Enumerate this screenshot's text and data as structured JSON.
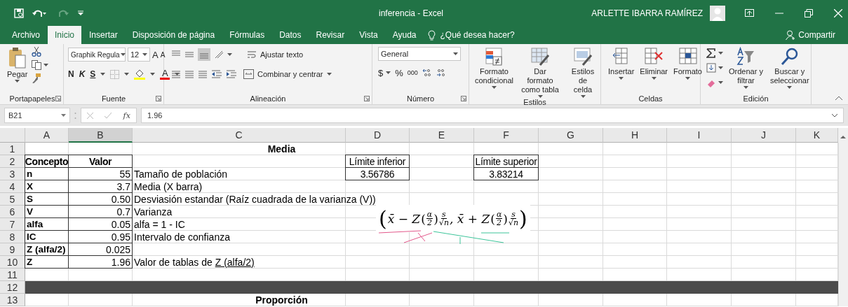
{
  "window": {
    "title": "inferencia - Excel",
    "user": "ARLETTE IBARRA RAMÍREZ"
  },
  "tabs": {
    "items": [
      {
        "label": "Archivo",
        "selected": false
      },
      {
        "label": "Inicio",
        "selected": true
      },
      {
        "label": "Insertar",
        "selected": false
      },
      {
        "label": "Disposición de página",
        "selected": false
      },
      {
        "label": "Fórmulas",
        "selected": false
      },
      {
        "label": "Datos",
        "selected": false
      },
      {
        "label": "Revisar",
        "selected": false
      },
      {
        "label": "Vista",
        "selected": false
      },
      {
        "label": "Ayuda",
        "selected": false
      }
    ],
    "tell_me": {
      "placeholder": "¿Qué desea hacer?"
    },
    "share": "Compartir"
  },
  "ribbon": {
    "clipboard": {
      "label": "Portapapeles",
      "paste": "Pegar"
    },
    "font": {
      "label": "Fuente",
      "font_name": "Graphik Regula",
      "font_size": "12",
      "grow": "A",
      "shrink": "A",
      "bold": "N",
      "italic": "K",
      "underline": "S",
      "font_color": "A"
    },
    "alignment": {
      "label": "Alineación",
      "wrap": "Ajustar texto",
      "merge": "Combinar y centrar"
    },
    "number": {
      "label": "Número",
      "format": "General",
      "currency": "$",
      "percent": "%",
      "thousands": "000"
    },
    "styles": {
      "label": "Estilos",
      "buttons": [
        {
          "lines": [
            "Formato",
            "condicional"
          ]
        },
        {
          "lines": [
            "Dar formato",
            "como tabla"
          ]
        },
        {
          "lines": [
            "Estilos de",
            "celda"
          ]
        }
      ]
    },
    "cells": {
      "label": "Celdas",
      "buttons": [
        "Insertar",
        "Eliminar",
        "Formato"
      ]
    },
    "editing": {
      "label": "Edición",
      "buttons": [
        {
          "lines": [
            "Ordenar y",
            "filtrar"
          ]
        },
        {
          "lines": [
            "Buscar y",
            "seleccionar"
          ]
        }
      ]
    }
  },
  "formula_bar": {
    "name_box": "B21",
    "fx": "fx",
    "value": "1.96"
  },
  "sheet": {
    "columns": [
      {
        "label": "A",
        "selected": false
      },
      {
        "label": "B",
        "selected": true
      },
      {
        "label": "C",
        "selected": false
      },
      {
        "label": "D",
        "selected": false
      },
      {
        "label": "E",
        "selected": false
      },
      {
        "label": "F",
        "selected": false
      },
      {
        "label": "G",
        "selected": false
      },
      {
        "label": "H",
        "selected": false
      },
      {
        "label": "I",
        "selected": false
      },
      {
        "label": "J",
        "selected": false
      },
      {
        "label": "K",
        "selected": false
      }
    ],
    "rows": [
      {
        "number": "1",
        "cells": [
          {
            "kind": "title",
            "text": "Media"
          }
        ]
      },
      {
        "number": "2",
        "cells": [
          {
            "kind": "header",
            "text": "Concepto"
          },
          {
            "kind": "header",
            "text": "Valor"
          },
          null,
          {
            "kind": "limit",
            "text": "Límite inferior"
          },
          null,
          {
            "kind": "limit",
            "text": "Límite superior"
          }
        ]
      },
      {
        "number": "3",
        "cells": [
          {
            "kind": "label",
            "text": "n"
          },
          {
            "kind": "value",
            "text": "55"
          },
          {
            "kind": "note",
            "text": "Tamaño de población"
          },
          {
            "kind": "limit",
            "text": "3.56786"
          },
          null,
          {
            "kind": "limit",
            "text": "3.83214"
          }
        ]
      },
      {
        "number": "4",
        "cells": [
          {
            "kind": "label",
            "text": "X"
          },
          {
            "kind": "value",
            "text": "3.7"
          },
          {
            "kind": "note",
            "text": "Media (X barra)"
          }
        ]
      },
      {
        "number": "5",
        "cells": [
          {
            "kind": "label",
            "text": "S"
          },
          {
            "kind": "value",
            "text": "0.50"
          },
          {
            "kind": "note",
            "text": "Desviasión estandar (Raíz cuadrada de la varianza (V))"
          }
        ]
      },
      {
        "number": "6",
        "cells": [
          {
            "kind": "label",
            "text": "V"
          },
          {
            "kind": "value",
            "text": "0.7"
          },
          {
            "kind": "note",
            "text": "Varianza"
          }
        ]
      },
      {
        "number": "7",
        "cells": [
          {
            "kind": "label",
            "text": "alfa"
          },
          {
            "kind": "value",
            "text": "0.05"
          },
          {
            "kind": "note",
            "text": "alfa = 1 - IC"
          }
        ]
      },
      {
        "number": "8",
        "cells": [
          {
            "kind": "label",
            "text": "IC"
          },
          {
            "kind": "value",
            "text": "0.95"
          },
          {
            "kind": "note",
            "text": "Intervalo de confianza"
          }
        ]
      },
      {
        "number": "9",
        "cells": [
          {
            "kind": "label",
            "text": "Z (alfa/2)"
          },
          {
            "kind": "value",
            "text": "0.025"
          }
        ]
      },
      {
        "number": "10",
        "cells": [
          {
            "kind": "label",
            "text": "Z"
          },
          {
            "kind": "value",
            "text": "1.96"
          },
          {
            "kind": "note",
            "text": "Valor de tablas de ",
            "link": "Z (alfa/2)"
          }
        ]
      },
      {
        "number": "11"
      },
      {
        "number": "12",
        "kind": "band"
      },
      {
        "number": "13",
        "cells": [
          {
            "kind": "title",
            "text": "Proporción"
          }
        ]
      }
    ],
    "formula": {
      "parts": [
        {
          "kind": "open",
          "text": "("
        },
        {
          "kind": "text",
          "text": "x̄ − Z"
        },
        {
          "kind": "paren",
          "text": "("
        },
        {
          "kind": "frac",
          "num": "α",
          "den": "2"
        },
        {
          "kind": "paren",
          "text": ")"
        },
        {
          "kind": "frac",
          "num": "s",
          "den": "√n"
        },
        {
          "kind": "text",
          "text": ", x̄ + Z"
        },
        {
          "kind": "paren",
          "text": "("
        },
        {
          "kind": "frac",
          "num": "α",
          "den": "2"
        },
        {
          "kind": "paren",
          "text": ")"
        },
        {
          "kind": "frac",
          "num": "s",
          "den": "√n"
        },
        {
          "kind": "open",
          "text": ")"
        }
      ]
    }
  }
}
